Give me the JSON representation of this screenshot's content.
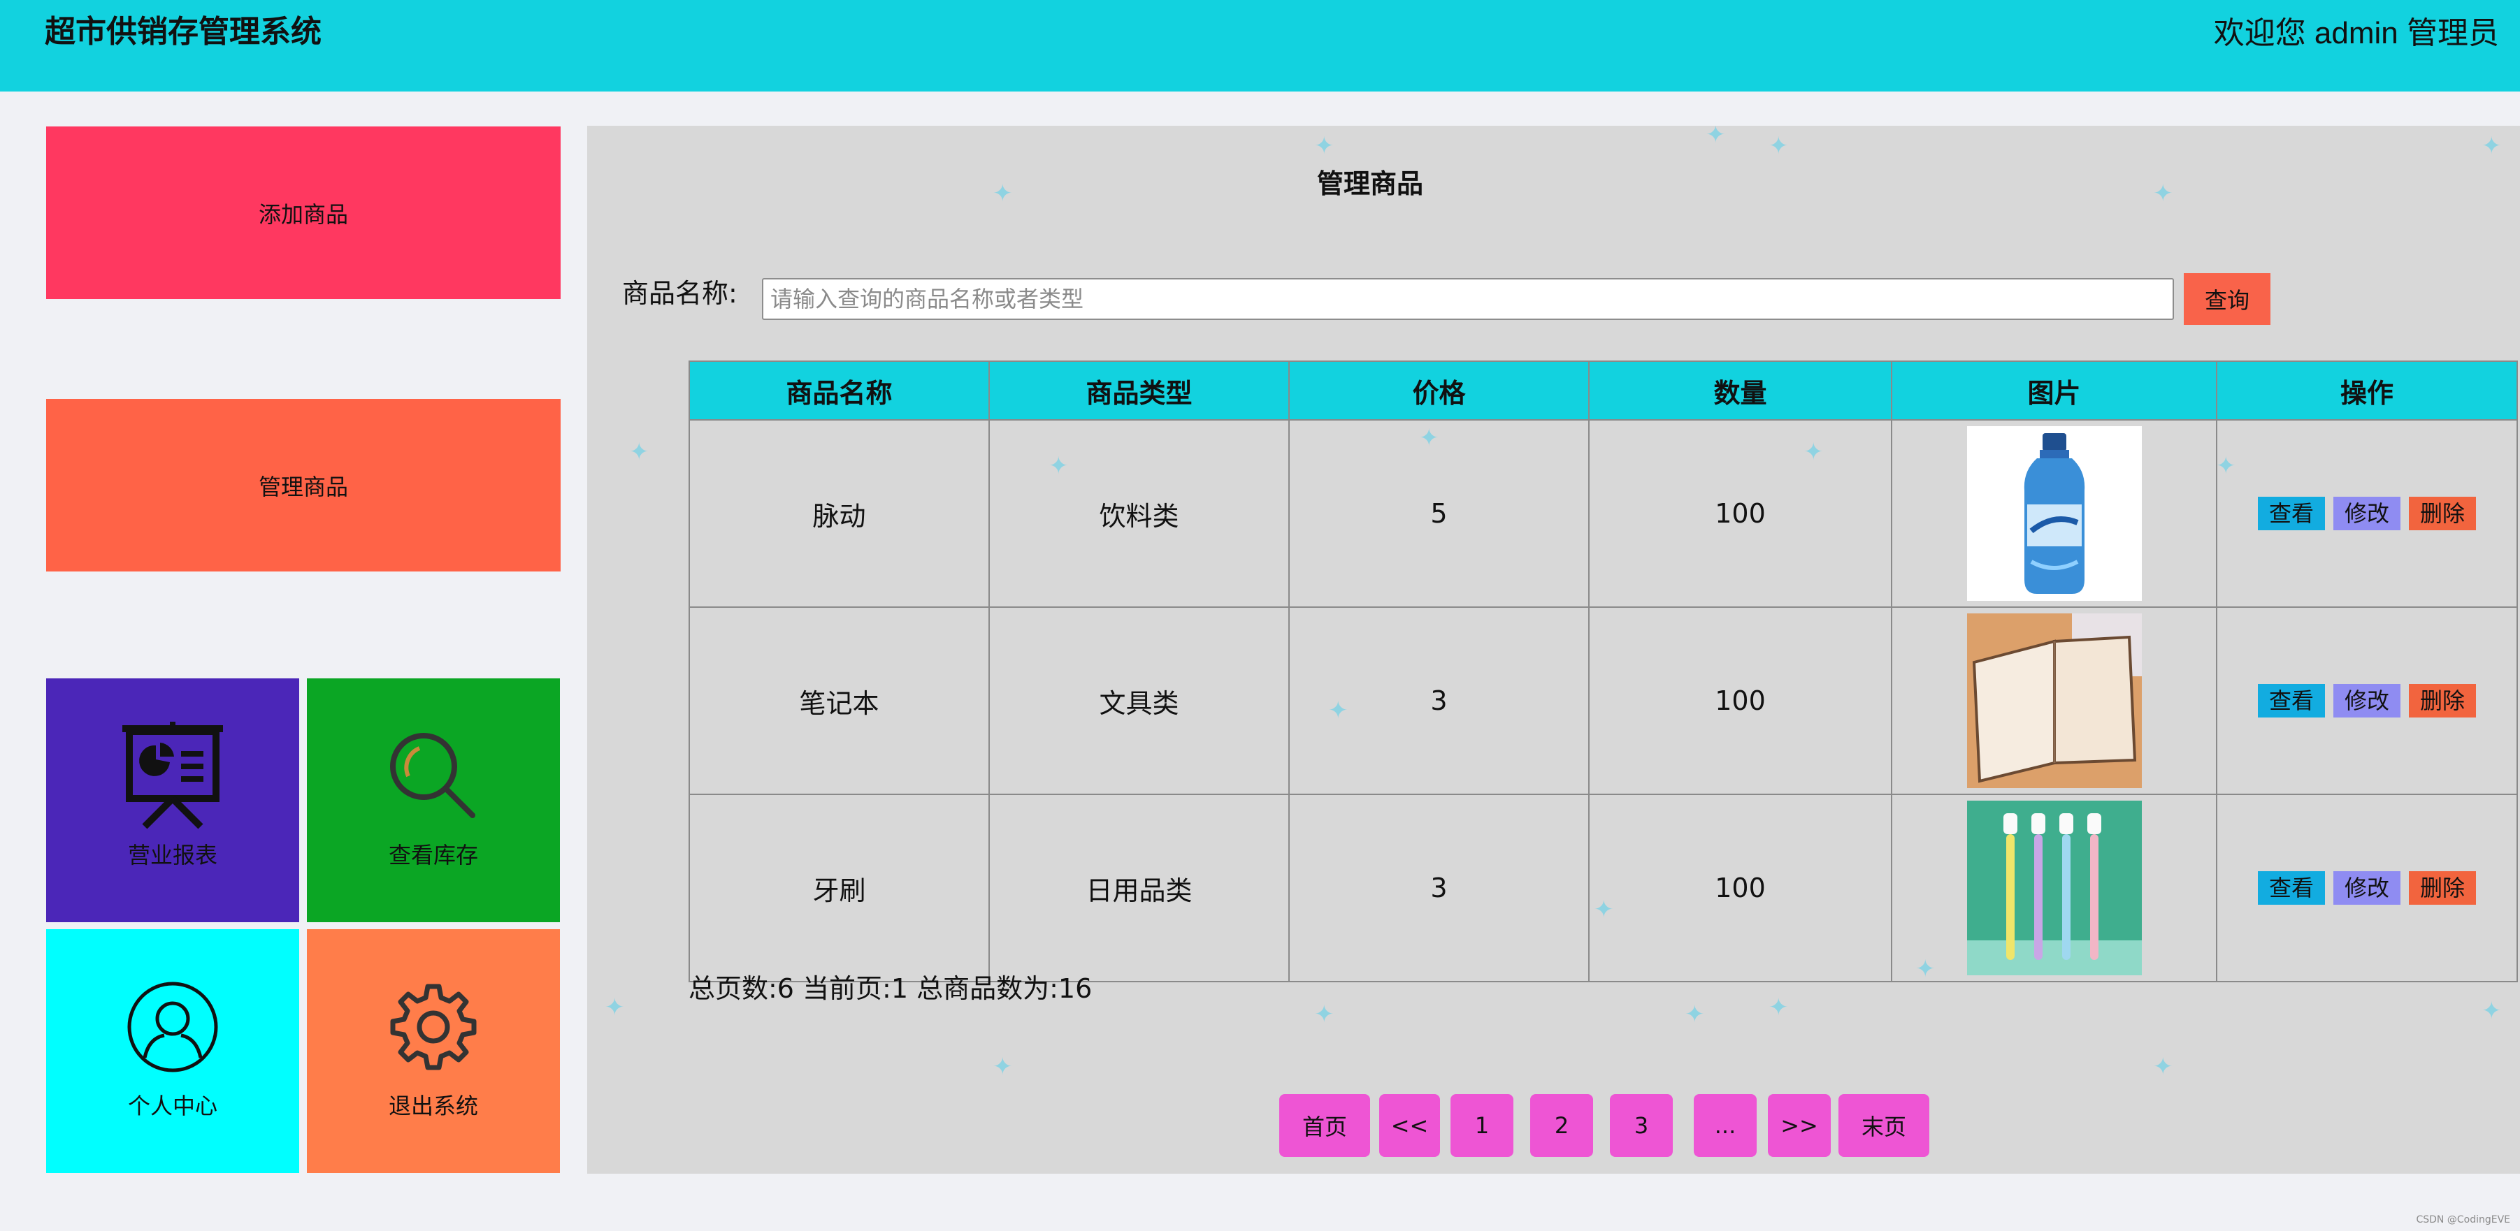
{
  "app": {
    "title": "超市供销存管理系统",
    "welcome": "欢迎您 admin 管理员"
  },
  "sidebar": {
    "add_product": "添加商品",
    "manage_product": "管理商品",
    "tiles": [
      {
        "label": "营业报表",
        "icon": "presentation-chart-icon",
        "color": "#4b26b8"
      },
      {
        "label": "查看库存",
        "icon": "magnifier-icon",
        "color": "#0ba624"
      },
      {
        "label": "个人中心",
        "icon": "user-icon",
        "color": "#00ffff"
      },
      {
        "label": "退出系统",
        "icon": "gear-icon",
        "color": "#ff7d4a"
      }
    ]
  },
  "main": {
    "title": "管理商品",
    "search": {
      "label": "商品名称:",
      "placeholder": "请输入查询的商品名称或者类型",
      "value": "",
      "button": "查询"
    },
    "table": {
      "headers": [
        "商品名称",
        "商品类型",
        "价格",
        "数量",
        "图片",
        "操作"
      ],
      "rows": [
        {
          "name": "脉动",
          "type": "饮料类",
          "price": "5",
          "qty": "100",
          "image": "drink-bottle"
        },
        {
          "name": "笔记本",
          "type": "文具类",
          "price": "3",
          "qty": "100",
          "image": "open-notebook"
        },
        {
          "name": "牙刷",
          "type": "日用品类",
          "price": "3",
          "qty": "100",
          "image": "toothbrushes"
        }
      ],
      "actions": {
        "view": "查看",
        "edit": "修改",
        "delete": "删除"
      }
    },
    "summary": "总页数:6 当前页:1 总商品数为:16",
    "pager": [
      "首页",
      "<<",
      "1",
      "2",
      "3",
      "...",
      ">>",
      "末页"
    ]
  },
  "colors": {
    "header": "#12d2df",
    "add_product": "#ff3860",
    "manage_product": "#ff6347",
    "search_button": "#f9634a",
    "view": "#12ace0",
    "edit": "#8f8cf2",
    "delete": "#f2643e",
    "pager": "#ee55d4"
  },
  "credit": "CSDN @CodingEVE"
}
